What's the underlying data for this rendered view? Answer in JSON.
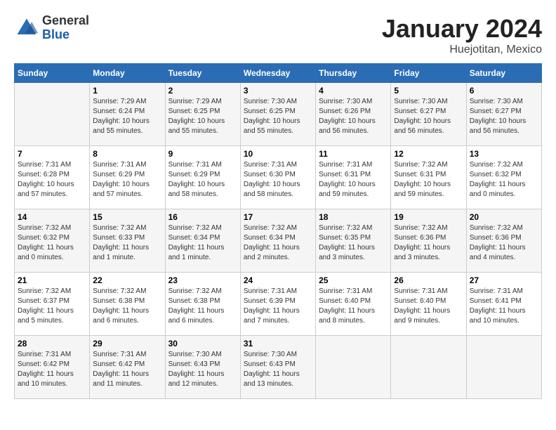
{
  "header": {
    "logo": {
      "general": "General",
      "blue": "Blue"
    },
    "title": "January 2024",
    "location": "Huejotitan, Mexico"
  },
  "weekdays": [
    "Sunday",
    "Monday",
    "Tuesday",
    "Wednesday",
    "Thursday",
    "Friday",
    "Saturday"
  ],
  "weeks": [
    [
      {
        "day": "",
        "sunrise": "",
        "sunset": "",
        "daylight": ""
      },
      {
        "day": "1",
        "sunrise": "Sunrise: 7:29 AM",
        "sunset": "Sunset: 6:24 PM",
        "daylight": "Daylight: 10 hours and 55 minutes."
      },
      {
        "day": "2",
        "sunrise": "Sunrise: 7:29 AM",
        "sunset": "Sunset: 6:25 PM",
        "daylight": "Daylight: 10 hours and 55 minutes."
      },
      {
        "day": "3",
        "sunrise": "Sunrise: 7:30 AM",
        "sunset": "Sunset: 6:25 PM",
        "daylight": "Daylight: 10 hours and 55 minutes."
      },
      {
        "day": "4",
        "sunrise": "Sunrise: 7:30 AM",
        "sunset": "Sunset: 6:26 PM",
        "daylight": "Daylight: 10 hours and 56 minutes."
      },
      {
        "day": "5",
        "sunrise": "Sunrise: 7:30 AM",
        "sunset": "Sunset: 6:27 PM",
        "daylight": "Daylight: 10 hours and 56 minutes."
      },
      {
        "day": "6",
        "sunrise": "Sunrise: 7:30 AM",
        "sunset": "Sunset: 6:27 PM",
        "daylight": "Daylight: 10 hours and 56 minutes."
      }
    ],
    [
      {
        "day": "7",
        "sunrise": "Sunrise: 7:31 AM",
        "sunset": "Sunset: 6:28 PM",
        "daylight": "Daylight: 10 hours and 57 minutes."
      },
      {
        "day": "8",
        "sunrise": "Sunrise: 7:31 AM",
        "sunset": "Sunset: 6:29 PM",
        "daylight": "Daylight: 10 hours and 57 minutes."
      },
      {
        "day": "9",
        "sunrise": "Sunrise: 7:31 AM",
        "sunset": "Sunset: 6:29 PM",
        "daylight": "Daylight: 10 hours and 58 minutes."
      },
      {
        "day": "10",
        "sunrise": "Sunrise: 7:31 AM",
        "sunset": "Sunset: 6:30 PM",
        "daylight": "Daylight: 10 hours and 58 minutes."
      },
      {
        "day": "11",
        "sunrise": "Sunrise: 7:31 AM",
        "sunset": "Sunset: 6:31 PM",
        "daylight": "Daylight: 10 hours and 59 minutes."
      },
      {
        "day": "12",
        "sunrise": "Sunrise: 7:32 AM",
        "sunset": "Sunset: 6:31 PM",
        "daylight": "Daylight: 10 hours and 59 minutes."
      },
      {
        "day": "13",
        "sunrise": "Sunrise: 7:32 AM",
        "sunset": "Sunset: 6:32 PM",
        "daylight": "Daylight: 11 hours and 0 minutes."
      }
    ],
    [
      {
        "day": "14",
        "sunrise": "Sunrise: 7:32 AM",
        "sunset": "Sunset: 6:32 PM",
        "daylight": "Daylight: 11 hours and 0 minutes."
      },
      {
        "day": "15",
        "sunrise": "Sunrise: 7:32 AM",
        "sunset": "Sunset: 6:33 PM",
        "daylight": "Daylight: 11 hours and 1 minute."
      },
      {
        "day": "16",
        "sunrise": "Sunrise: 7:32 AM",
        "sunset": "Sunset: 6:34 PM",
        "daylight": "Daylight: 11 hours and 1 minute."
      },
      {
        "day": "17",
        "sunrise": "Sunrise: 7:32 AM",
        "sunset": "Sunset: 6:34 PM",
        "daylight": "Daylight: 11 hours and 2 minutes."
      },
      {
        "day": "18",
        "sunrise": "Sunrise: 7:32 AM",
        "sunset": "Sunset: 6:35 PM",
        "daylight": "Daylight: 11 hours and 3 minutes."
      },
      {
        "day": "19",
        "sunrise": "Sunrise: 7:32 AM",
        "sunset": "Sunset: 6:36 PM",
        "daylight": "Daylight: 11 hours and 3 minutes."
      },
      {
        "day": "20",
        "sunrise": "Sunrise: 7:32 AM",
        "sunset": "Sunset: 6:36 PM",
        "daylight": "Daylight: 11 hours and 4 minutes."
      }
    ],
    [
      {
        "day": "21",
        "sunrise": "Sunrise: 7:32 AM",
        "sunset": "Sunset: 6:37 PM",
        "daylight": "Daylight: 11 hours and 5 minutes."
      },
      {
        "day": "22",
        "sunrise": "Sunrise: 7:32 AM",
        "sunset": "Sunset: 6:38 PM",
        "daylight": "Daylight: 11 hours and 6 minutes."
      },
      {
        "day": "23",
        "sunrise": "Sunrise: 7:32 AM",
        "sunset": "Sunset: 6:38 PM",
        "daylight": "Daylight: 11 hours and 6 minutes."
      },
      {
        "day": "24",
        "sunrise": "Sunrise: 7:31 AM",
        "sunset": "Sunset: 6:39 PM",
        "daylight": "Daylight: 11 hours and 7 minutes."
      },
      {
        "day": "25",
        "sunrise": "Sunrise: 7:31 AM",
        "sunset": "Sunset: 6:40 PM",
        "daylight": "Daylight: 11 hours and 8 minutes."
      },
      {
        "day": "26",
        "sunrise": "Sunrise: 7:31 AM",
        "sunset": "Sunset: 6:40 PM",
        "daylight": "Daylight: 11 hours and 9 minutes."
      },
      {
        "day": "27",
        "sunrise": "Sunrise: 7:31 AM",
        "sunset": "Sunset: 6:41 PM",
        "daylight": "Daylight: 11 hours and 10 minutes."
      }
    ],
    [
      {
        "day": "28",
        "sunrise": "Sunrise: 7:31 AM",
        "sunset": "Sunset: 6:42 PM",
        "daylight": "Daylight: 11 hours and 10 minutes."
      },
      {
        "day": "29",
        "sunrise": "Sunrise: 7:31 AM",
        "sunset": "Sunset: 6:42 PM",
        "daylight": "Daylight: 11 hours and 11 minutes."
      },
      {
        "day": "30",
        "sunrise": "Sunrise: 7:30 AM",
        "sunset": "Sunset: 6:43 PM",
        "daylight": "Daylight: 11 hours and 12 minutes."
      },
      {
        "day": "31",
        "sunrise": "Sunrise: 7:30 AM",
        "sunset": "Sunset: 6:43 PM",
        "daylight": "Daylight: 11 hours and 13 minutes."
      },
      {
        "day": "",
        "sunrise": "",
        "sunset": "",
        "daylight": ""
      },
      {
        "day": "",
        "sunrise": "",
        "sunset": "",
        "daylight": ""
      },
      {
        "day": "",
        "sunrise": "",
        "sunset": "",
        "daylight": ""
      }
    ]
  ]
}
